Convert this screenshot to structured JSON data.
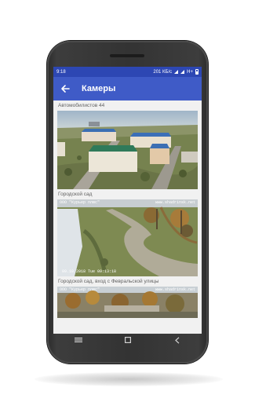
{
  "status": {
    "time": "9:18",
    "speed": "201 КБ/с",
    "net": "H+"
  },
  "header": {
    "title": "Камеры",
    "back_icon": "arrow-back-icon"
  },
  "cameras": [
    {
      "label": "Автомобилистов 44"
    },
    {
      "label": "Городской сад",
      "overlay_tl": "ООО \"Курьер плюс\"",
      "overlay_tr": "www.shadrinsk.net",
      "overlay_bl": "09.10.2018 Tue 09:13:18"
    },
    {
      "label": "Городской сад, вход с Февральской улицы",
      "overlay_tl": "ООО \"Курьер плюс\"",
      "overlay_tr": "www.shadrinsk.net"
    }
  ],
  "navigation": {
    "menu_icon": "menu-icon",
    "home_icon": "home-square-icon",
    "back_icon": "back-chevron-icon"
  },
  "colors": {
    "statusbar": "#2d47b3",
    "appbar": "#3f5bc7",
    "background": "#f1f1f1"
  }
}
